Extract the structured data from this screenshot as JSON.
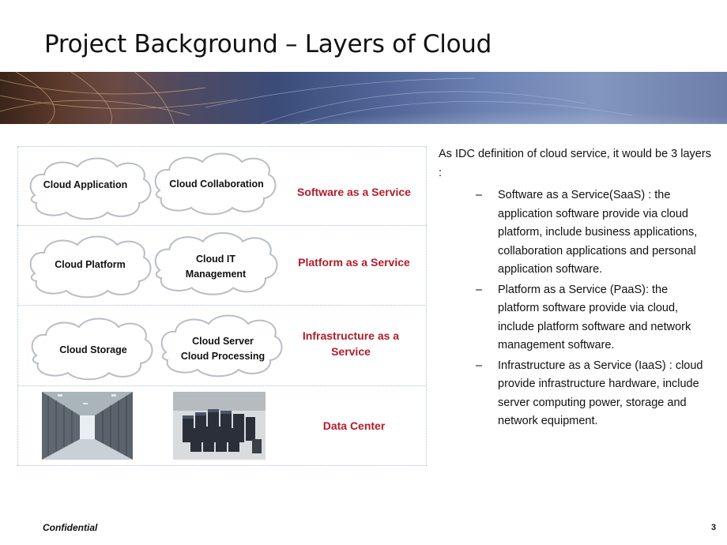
{
  "title": "Project Background – Layers of Cloud",
  "layers": [
    {
      "label": "Software as a Service",
      "clouds": [
        "Cloud Application",
        "Cloud Collaboration"
      ]
    },
    {
      "label": "Platform as a Service",
      "clouds": [
        "Cloud Platform",
        "Cloud IT\nManagement"
      ]
    },
    {
      "label": "Infrastructure as a\nService",
      "clouds": [
        "Cloud Storage",
        "Cloud Server\nCloud Processing"
      ]
    },
    {
      "label": "Data Center",
      "images": [
        "server-aisle-photo",
        "server-racks-photo"
      ]
    }
  ],
  "description": {
    "intro": "As IDC definition of cloud service, it would be 3 layers :",
    "bullets": [
      "Software as a Service(SaaS) : the application software provide via cloud platform, include business applications, collaboration applications and personal application software.",
      "Platform as a Service (PaaS):  the platform software provide via cloud, include platform software and network management software.",
      "Infrastructure as a Service (IaaS) : cloud provide infrastructure hardware, include server computing power, storage and network equipment."
    ]
  },
  "footer": {
    "confidential": "Confidential",
    "page_number": "3"
  },
  "colors": {
    "accent_red": "#b01c2a",
    "grid_line": "#a9bdd4"
  }
}
